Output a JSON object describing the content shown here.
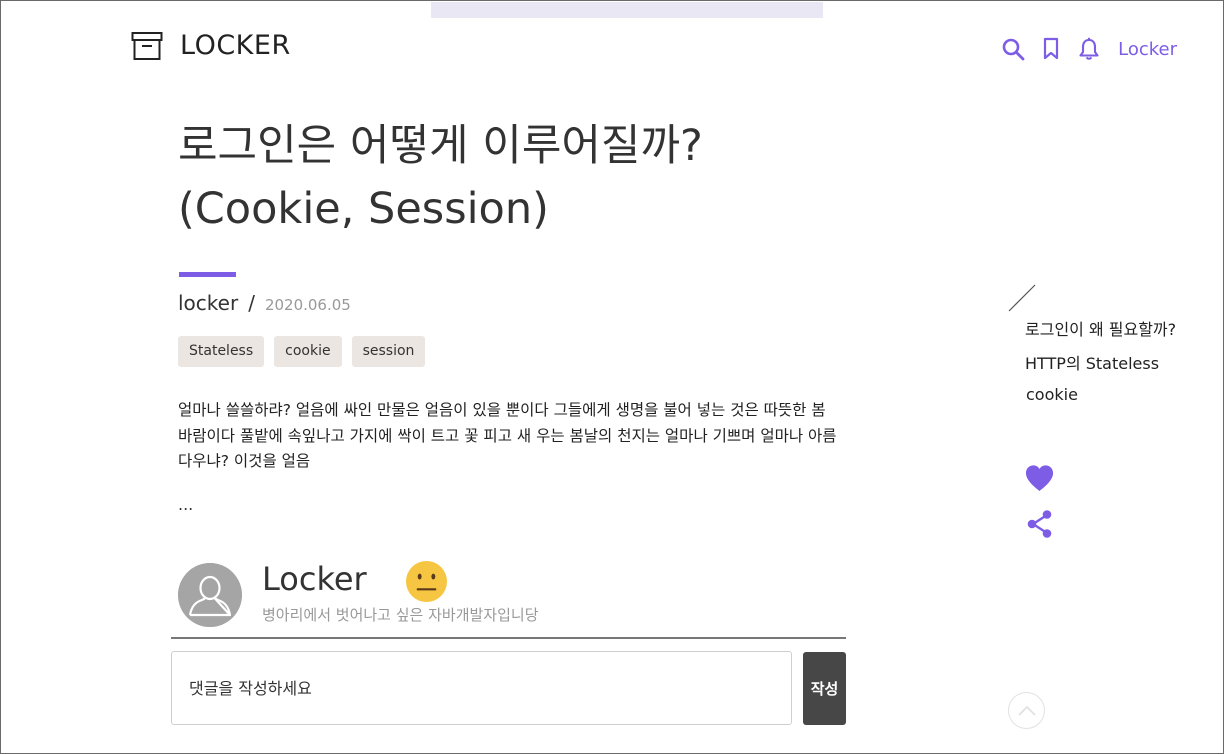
{
  "header": {
    "logo_text": "LOCKER",
    "logo_icon": "archive-box-icon",
    "icons": [
      "search-icon",
      "bookmark-icon",
      "bell-icon"
    ],
    "user_label": "Locker",
    "accent": "#7d5ce6"
  },
  "post": {
    "title_line1": "로그인은 어떻게 이루어질까?",
    "title_line2": "(Cookie, Session)",
    "author": "locker",
    "separator": "/",
    "date": "2020.06.05",
    "tags": [
      "Stateless",
      "cookie",
      "session"
    ],
    "excerpt": "얼마나 쓸쓸하랴? 얼음에 싸인 만물은 얼음이 있을 뿐이다 그들에게 생명을 불어 넣는 것은 따뜻한 봄바람이다 풀밭에 속잎나고 가지에 싹이 트고 꽃 피고 새 우는 봄날의 천지는 얼마나 기쁘며 얼마나 아름다우냐? 이것을 얼음",
    "ellipsis": "..."
  },
  "author_card": {
    "name": "Locker",
    "bio": "병아리에서 벗어나고 싶은 자바개발자입니당",
    "avatar_icon": "default-avatar-icon",
    "emoji_icon": "neutral-face-emoji-icon"
  },
  "comment": {
    "placeholder": "댓글을 작성하세요",
    "submit_label": "작성"
  },
  "toc": {
    "items": [
      "로그인이 왜 필요할까?",
      "HTTP의 Stateless",
      "cookie"
    ]
  },
  "actions": {
    "like_icon": "heart-icon",
    "share_icon": "share-icon",
    "scroll_top_icon": "chevron-up-icon"
  }
}
